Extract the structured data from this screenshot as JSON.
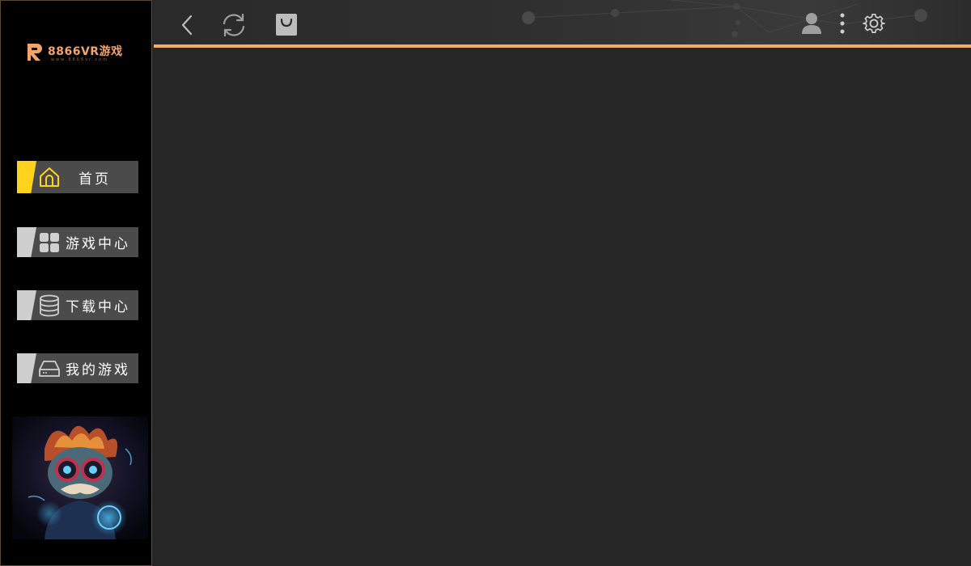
{
  "app": {
    "logo_text": "8866VR游戏",
    "logo_subtext": "www.8866vr.com"
  },
  "nav": {
    "items": [
      {
        "label": "首页",
        "icon": "home-icon",
        "active": true
      },
      {
        "label": "游戏中心",
        "icon": "grid-icon",
        "active": false
      },
      {
        "label": "下载中心",
        "icon": "database-icon",
        "active": false
      },
      {
        "label": "我的游戏",
        "icon": "harddrive-icon",
        "active": false
      }
    ]
  },
  "toolbar": {
    "back_icon": "chevron-left-icon",
    "refresh_icon": "refresh-icon",
    "store_icon": "shopping-bag-icon",
    "user_icon": "user-icon",
    "more_icon": "more-vertical-icon",
    "settings_icon": "gear-icon"
  },
  "colors": {
    "accent": "#f0ad6a",
    "active_tab": "#ffd21e",
    "inactive_tab": "#cfcfcf",
    "sidebar_bg": "#000000",
    "content_bg": "#262626",
    "nav_bg": "#4b4b4b"
  }
}
